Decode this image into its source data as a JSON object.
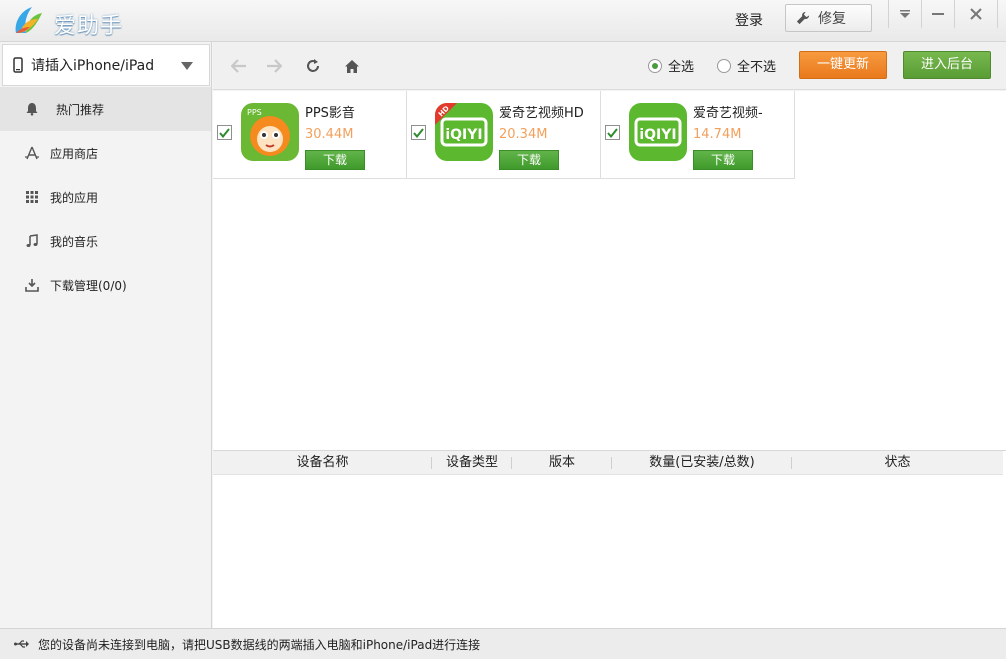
{
  "header": {
    "app_title": "爱助手",
    "login_label": "登录",
    "repair_label": "修复"
  },
  "sidebar": {
    "device_label": "请插入iPhone/iPad",
    "items": [
      {
        "label": "热门推荐",
        "icon": "bell-icon",
        "active": true
      },
      {
        "label": "应用商店",
        "icon": "appstore-icon"
      },
      {
        "label": "我的应用",
        "icon": "grid-icon"
      },
      {
        "label": "我的音乐",
        "icon": "music-icon"
      },
      {
        "label": "下载管理(0/0)",
        "icon": "download-icon"
      }
    ]
  },
  "toolbar": {
    "select_all_label": "全选",
    "select_none_label": "全不选",
    "one_click_update_label": "一键更新",
    "enter_background_label": "进入后台"
  },
  "apps": [
    {
      "name": "PPS影音",
      "size": "30.44M",
      "download_label": "下载",
      "checked": true,
      "icon_text": "PPS"
    },
    {
      "name": "爱奇艺视频HD",
      "size": "20.34M",
      "download_label": "下载",
      "checked": true,
      "icon_text": "iQIYI",
      "badge": "HD"
    },
    {
      "name": "爱奇艺视频-",
      "size": "14.74M",
      "download_label": "下载",
      "checked": true,
      "icon_text": "iQIYI"
    }
  ],
  "device_table": {
    "columns": [
      "设备名称",
      "设备类型",
      "版本",
      "数量(已安装/总数)",
      "状态"
    ]
  },
  "status": {
    "message": "您的设备尚未连接到电脑，请把USB数据线的两端插入电脑和iPhone/iPad进行连接"
  },
  "colors": {
    "accent_green": "#5a9c35",
    "accent_orange": "#e9791c",
    "size_text": "#f2a05c"
  }
}
